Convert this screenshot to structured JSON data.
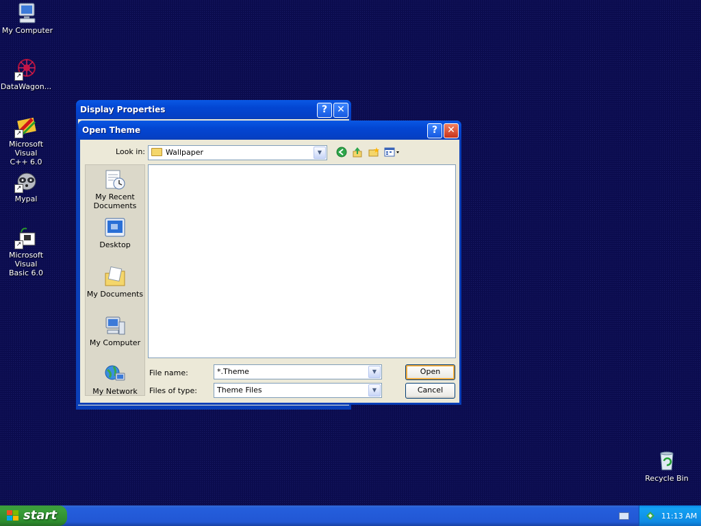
{
  "desktop": {
    "icons": [
      {
        "label": "My Computer"
      },
      {
        "label": "DataWagon..."
      },
      {
        "label": "Microsoft Visual\nC++ 6.0"
      },
      {
        "label": "Mypal"
      },
      {
        "label": "Microsoft Visual\nBasic 6.0"
      },
      {
        "label": "Recycle Bin"
      }
    ]
  },
  "display_properties": {
    "title": "Display Properties",
    "help_label": "?",
    "close_label": "✕"
  },
  "open_theme": {
    "title": "Open Theme",
    "help_label": "?",
    "close_label": "✕",
    "look_in_label": "Look in:",
    "look_in_value": "Wallpaper",
    "places": [
      {
        "label": "My Recent\nDocuments"
      },
      {
        "label": "Desktop"
      },
      {
        "label": "My Documents"
      },
      {
        "label": "My Computer"
      },
      {
        "label": "My Network"
      }
    ],
    "file_name_label": "File name:",
    "file_name_value": "*.Theme",
    "files_of_type_label": "Files of type:",
    "files_of_type_value": "Theme Files",
    "open_button": "Open",
    "cancel_button": "Cancel"
  },
  "taskbar": {
    "start_label": "start",
    "clock": "11:13 AM"
  },
  "colors": {
    "desktop_bg": "#0b0c4e",
    "titlebar": "#0346d2",
    "dialog_bg": "#ece9d8",
    "taskbar": "#245edc",
    "start_button": "#3a9f3a",
    "tray": "#0f8ae3"
  }
}
